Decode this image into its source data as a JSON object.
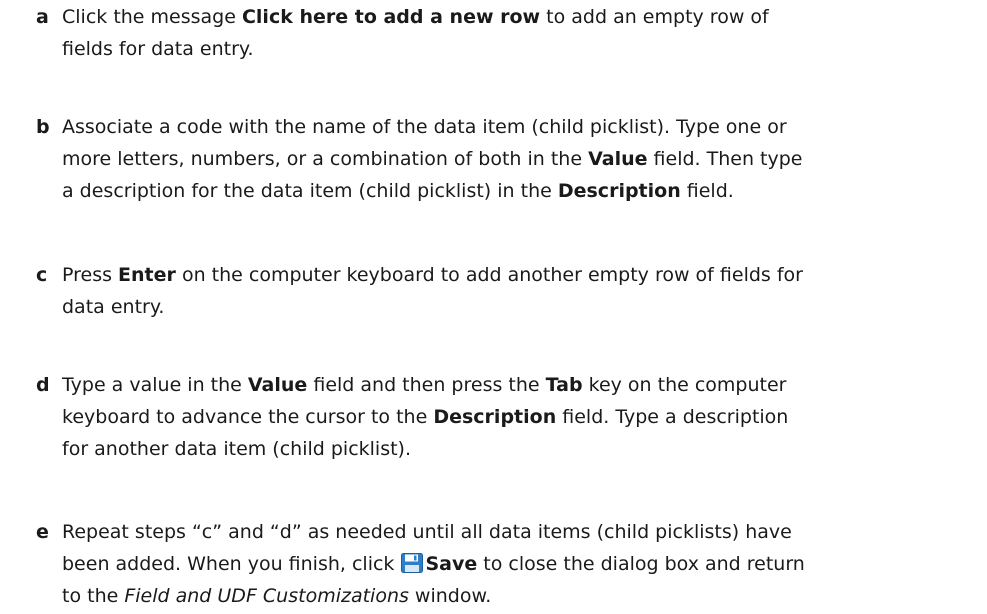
{
  "steps": [
    {
      "letter": "a",
      "lines": [
        [
          "Click the message ",
          "Click here to add a new row",
          " to add an empty row of"
        ],
        [
          "fields for data entry."
        ]
      ]
    },
    {
      "letter": "b",
      "lines": [
        [
          "Associate a code with the name of the data item (child picklist). Type one or"
        ],
        [
          "more letters, numbers, or a combination of both in the ",
          "Value",
          " field. Then type"
        ],
        [
          "a description for the data item (child picklist) in the ",
          "Description",
          " field."
        ]
      ]
    },
    {
      "letter": "c",
      "lines": [
        [
          "Press ",
          "Enter",
          " on the computer keyboard to add another empty row of fields for"
        ],
        [
          "data entry."
        ]
      ]
    },
    {
      "letter": "d",
      "lines": [
        [
          "Type a value in the ",
          "Value",
          " field and then press the ",
          "Tab",
          " key on the computer"
        ],
        [
          "keyboard to advance the cursor to the ",
          "Description",
          " field. Type a description"
        ],
        [
          "for another data item (child picklist)."
        ]
      ]
    },
    {
      "letter": "e",
      "lines": [
        [
          "Repeat steps “c” and “d” as needed until all data items (child picklists) have"
        ],
        [
          "been added. When you finish, click ",
          "Save",
          " to close the dialog box and return"
        ],
        [
          "to the ",
          "Field and UDF Customizations",
          " window."
        ]
      ]
    }
  ],
  "icons": {
    "save": "save-floppy-icon"
  },
  "colors": {
    "text": "#1a1a1a",
    "save_icon_body": "#2e7fc7",
    "save_icon_label": "#ffffff"
  }
}
